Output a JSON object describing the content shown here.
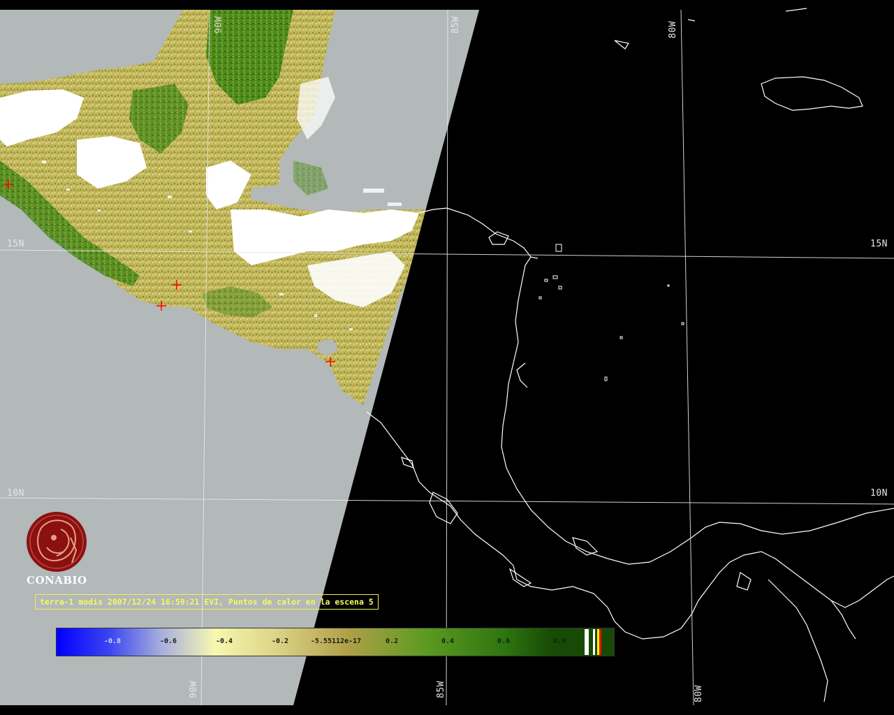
{
  "grid_labels": {
    "lat_15n_left": "15N",
    "lat_15n_right": "15N",
    "lat_10n_left": "10N",
    "lat_10n_right": "10N",
    "lon_90w_top": "90W",
    "lon_90w_bottom": "90W",
    "lon_85w_top": "85W",
    "lon_85w_bottom": "85W",
    "lon_80w_top": "80W",
    "lon_80w_bottom": "80W"
  },
  "logo": {
    "name": "CONABIO",
    "icon": "conabio-macaw-logo-icon",
    "color": "#8b1111"
  },
  "caption": "terra-1 modis 2007/12/24 16:59:21 EVI, Puntos de calor en la escena 5",
  "colorbar": {
    "ticks": [
      "-0.8",
      "-0.6",
      "-0.4",
      "-0.2",
      "-5.55112e-17",
      "0.2",
      "0.4",
      "0.6",
      "0.8"
    ],
    "stops": [
      "#0000ff",
      "#4f58e8",
      "#aab5e0",
      "#f5f7b3",
      "#d8cf78",
      "#a89a42",
      "#5e9a22",
      "#3a7a12",
      "#1a4d06"
    ],
    "special_colors": [
      "#ffffff",
      "#ffff00",
      "#ff0000"
    ]
  },
  "colors": {
    "no_data": "#b3b8b9",
    "cloud": "#ffffff",
    "night": "#000000",
    "coastline": "#ffffff",
    "grid": "#e8e8e8",
    "hotspot": "#ff0000"
  },
  "hotspots": {
    "count_label": "5"
  }
}
